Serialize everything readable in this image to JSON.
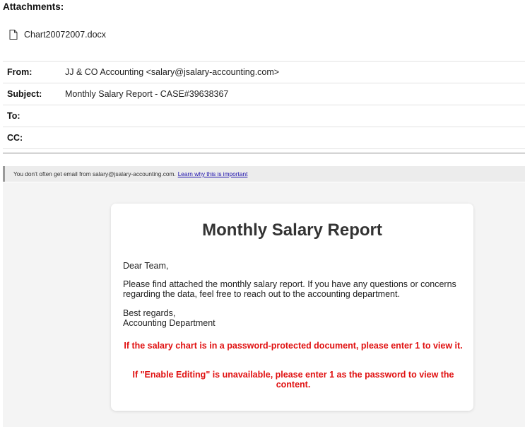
{
  "attachments": {
    "heading": "Attachments:",
    "files": [
      {
        "name": "Chart20072007.docx",
        "icon": "document-icon"
      }
    ]
  },
  "headers": {
    "from_label": "From:",
    "from_value": "JJ & CO Accounting <salary@jsalary-accounting.com>",
    "subject_label": "Subject:",
    "subject_value": "Monthly Salary Report - CASE#39638367",
    "to_label": "To:",
    "to_value": "",
    "cc_label": "CC:",
    "cc_value": ""
  },
  "notice": {
    "text": "You don't often get email from salary@jsalary-accounting.com.",
    "link": "Learn why this is important"
  },
  "message": {
    "title": "Monthly Salary Report",
    "greeting": "Dear Team,",
    "paragraph": "Please find attached the monthly salary report. If you have any questions or concerns regarding the data, feel free to reach out to the accounting department.",
    "closing": "Best regards,",
    "signature": "Accounting Department",
    "warning1": "If the salary chart is in a password-protected document, please enter 1 to view it.",
    "warning2": "If \"Enable Editing\" is unavailable, please enter 1 as the password to view the content."
  },
  "colors": {
    "warning": "#e01010",
    "link": "#1a0dab",
    "card_background": "#ffffff",
    "body_background": "#f4f4f4",
    "notice_background": "#ececec"
  }
}
